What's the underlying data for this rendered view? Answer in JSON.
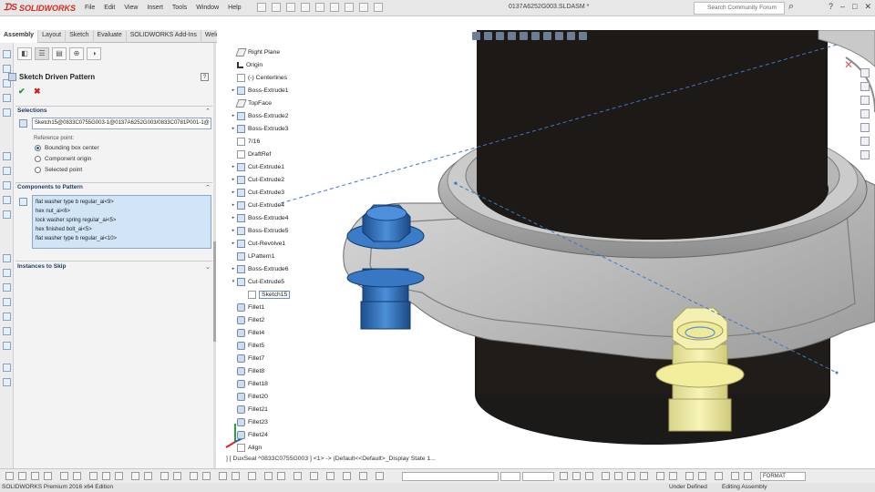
{
  "app": {
    "brand": "SOLIDWORKS",
    "document_title": "0137A6252G003.SLDASM *",
    "menu": [
      "File",
      "Edit",
      "View",
      "Insert",
      "Tools",
      "Window",
      "Help"
    ],
    "search_placeholder": "Search Community Forum",
    "window_controls": [
      "?",
      "–",
      "□",
      "✕"
    ]
  },
  "tabs": [
    "Assembly",
    "Layout",
    "Sketch",
    "Evaluate",
    "SOLIDWORKS Add-Ins",
    "Weldments"
  ],
  "property_manager": {
    "title": "Sketch Driven Pattern",
    "help": "?",
    "ok": "✔",
    "cancel": "✖",
    "selections": {
      "header": "Selections",
      "sketch_value": "Sketch15@0833C0755G003-1@0137A6252G003/0833C0781P001-1@",
      "reference_label": "Reference point:",
      "options": [
        {
          "label": "Bounding box center",
          "selected": true
        },
        {
          "label": "Component origin",
          "selected": false
        },
        {
          "label": "Selected point",
          "selected": false
        }
      ]
    },
    "components": {
      "header": "Components to Pattern",
      "items": [
        "flat washer type b regular_ai<9>",
        "hex nut_ai<6>",
        "lock washer spring regular_ai<5>",
        "hex finished bolt_ai<5>",
        "flat washer type b regular_ai<10>"
      ]
    },
    "instances": {
      "header": "Instances to Skip"
    }
  },
  "tree": [
    {
      "label": "Right Plane",
      "kind": "plane",
      "tw": ""
    },
    {
      "label": "Origin",
      "kind": "origin",
      "tw": ""
    },
    {
      "label": "(-) Centerlines",
      "kind": "sketch",
      "tw": ""
    },
    {
      "label": "Boss-Extrude1",
      "kind": "feature",
      "tw": "▸"
    },
    {
      "label": "TopFace",
      "kind": "plane",
      "tw": ""
    },
    {
      "label": "Boss-Extrude2",
      "kind": "feature",
      "tw": "▸"
    },
    {
      "label": "Boss-Extrude3",
      "kind": "feature",
      "tw": "▸"
    },
    {
      "label": "7/16",
      "kind": "sketch",
      "tw": ""
    },
    {
      "label": "DraftRef",
      "kind": "sketch",
      "tw": ""
    },
    {
      "label": "Cut-Extrude1",
      "kind": "feature",
      "tw": "▸"
    },
    {
      "label": "Cut-Extrude2",
      "kind": "feature",
      "tw": "▸"
    },
    {
      "label": "Cut-Extrude3",
      "kind": "feature",
      "tw": "▸"
    },
    {
      "label": "Cut-Extrude4",
      "kind": "feature",
      "tw": "▸"
    },
    {
      "label": "Boss-Extrude4",
      "kind": "feature",
      "tw": "▸"
    },
    {
      "label": "Boss-Extrude5",
      "kind": "feature",
      "tw": "▸"
    },
    {
      "label": "Cut-Revolve1",
      "kind": "feature",
      "tw": "▸"
    },
    {
      "label": "LPattern1",
      "kind": "feature",
      "tw": ""
    },
    {
      "label": "Boss-Extrude6",
      "kind": "feature",
      "tw": "▸"
    },
    {
      "label": "Cut-Extrude5",
      "kind": "feature",
      "tw": "▾"
    },
    {
      "label": "Sketch15",
      "kind": "sketch",
      "tw": "",
      "child": true,
      "selected": true
    },
    {
      "label": "Fillet1",
      "kind": "fillet",
      "tw": ""
    },
    {
      "label": "Fillet2",
      "kind": "fillet",
      "tw": ""
    },
    {
      "label": "Fillet4",
      "kind": "fillet",
      "tw": ""
    },
    {
      "label": "Fillet5",
      "kind": "fillet",
      "tw": ""
    },
    {
      "label": "Fillet7",
      "kind": "fillet",
      "tw": ""
    },
    {
      "label": "Fillet8",
      "kind": "fillet",
      "tw": ""
    },
    {
      "label": "Fillet18",
      "kind": "fillet",
      "tw": ""
    },
    {
      "label": "Fillet20",
      "kind": "fillet",
      "tw": ""
    },
    {
      "label": "Fillet21",
      "kind": "fillet",
      "tw": ""
    },
    {
      "label": "Fillet23",
      "kind": "fillet",
      "tw": ""
    },
    {
      "label": "Fillet24",
      "kind": "fillet",
      "tw": ""
    },
    {
      "label": "Align",
      "kind": "sketch",
      "tw": ""
    }
  ],
  "viewport": {
    "readout": "] [ DuxSeal ^0833C0755G003 ] <1> -> (Default<<Default>_Display State 1..."
  },
  "bottom_toolbar": {
    "format": "FORMAT"
  },
  "status": {
    "edition": "SOLIDWORKS Premium 2016 x64 Edition",
    "defined": "Under Defined",
    "mode": "Editing Assembly"
  }
}
